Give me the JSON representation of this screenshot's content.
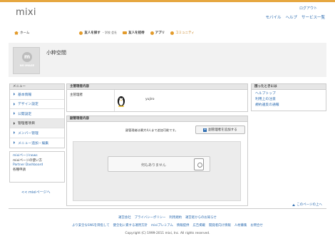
{
  "header": {
    "logo": "mixi",
    "logout": "ログアウト",
    "nav": [
      "モバイル",
      "ヘルプ",
      "サービス一覧"
    ]
  },
  "global_nav": {
    "home": "ホーム",
    "find_friends": "友人を探す",
    "find_friends_sub": "・学校 会社",
    "invite": "友人を招待",
    "app": "アプリ",
    "community": "コミュニティ"
  },
  "community": {
    "title": "小粋空間",
    "avatar_text": "NO IMAGE",
    "avatar_initial": "m"
  },
  "sidebar": {
    "header": "メニュー",
    "items": [
      {
        "label": "基本情報",
        "active": false
      },
      {
        "label": "デザイン設定",
        "active": false
      },
      {
        "label": "公開設定",
        "active": false
      },
      {
        "label": "管理者項目",
        "active": true
      },
      {
        "label": "メンバー管理",
        "active": false
      },
      {
        "label": "メニュー追加・編集",
        "active": false
      }
    ],
    "links": [
      {
        "label": "mixiページnews",
        "plain": false
      },
      {
        "label": "mixiページの使い方",
        "plain": true
      },
      {
        "label": "Partner Dashboard",
        "plain": false
      },
      {
        "label": "各種申請",
        "plain": true
      }
    ],
    "back": "<< mixiページへ"
  },
  "main": {
    "admin_panel": {
      "title": "主管理者内容",
      "label": "主管理者",
      "admin_name": "yujiro"
    },
    "sub_admin_panel": {
      "title": "副管理者内容",
      "note": "副管理者は最大4人まで追加可能です。",
      "add_button": "副管理者を追加する",
      "empty": "何もありません"
    }
  },
  "help": {
    "title": "困ったときには",
    "links": [
      "ヘルプトップ",
      "利用上の注意",
      "規約違反の通報"
    ]
  },
  "page_top": "このページの上へ",
  "footer": {
    "row1": [
      "運営会社",
      "プライバシーポリシー",
      "利用規約",
      "運営者からのお知らせ"
    ],
    "row2": [
      "より安全なSNSを目指して",
      "健全化に資する運用方針",
      "mixiプレミアム",
      "情報提供",
      "広告掲載",
      "開発者向け情報",
      "人材募集",
      "お問合せ"
    ],
    "copyright": "Copyright (C) 1999-2011 mixi, Inc. All rights reserved."
  },
  "colors": {
    "accent": "#e6a740",
    "link": "#2b6bb0",
    "nav_icon": "#e39b2b"
  }
}
